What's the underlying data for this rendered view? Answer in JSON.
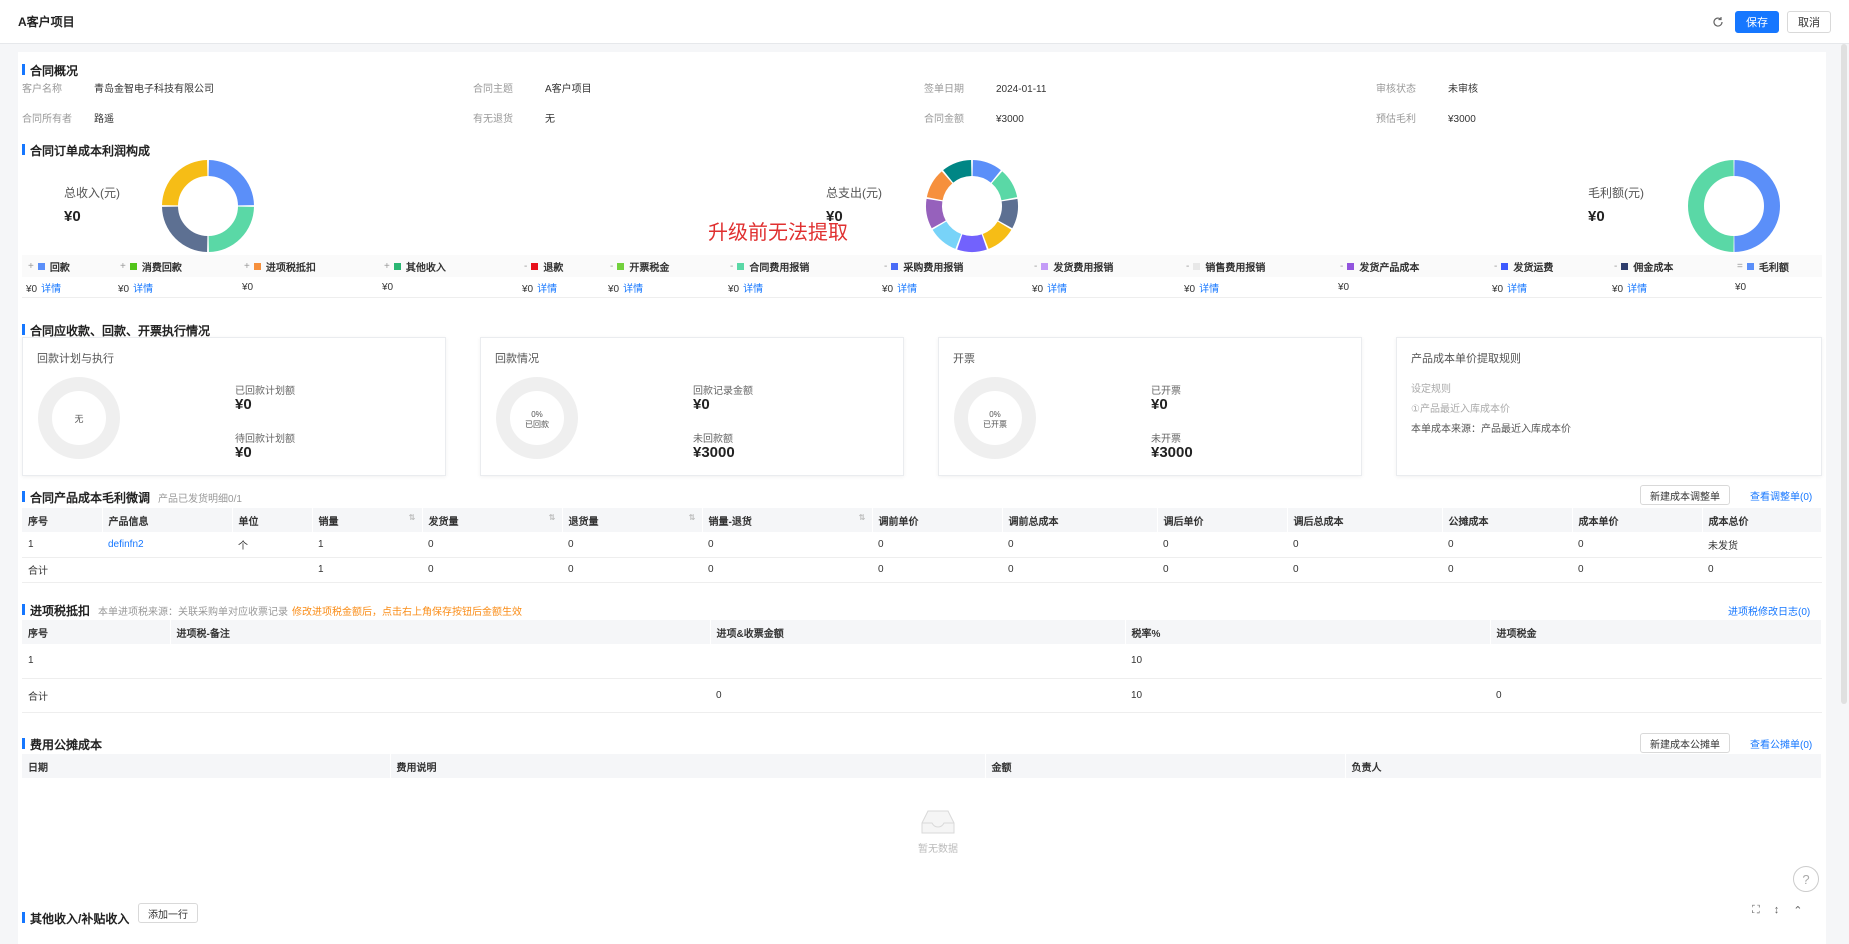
{
  "header": {
    "title": "A客户项目",
    "save_label": "保存",
    "cancel_label": "取消",
    "refresh_icon": "refresh-icon"
  },
  "overview": {
    "title": "合同概况",
    "fields": [
      {
        "label": "客户名称",
        "value": "青岛金智电子科技有限公司"
      },
      {
        "label": "合同主题",
        "value": "A客户项目"
      },
      {
        "label": "签单日期",
        "value": "2024-01-11"
      },
      {
        "label": "审核状态",
        "value": "未审核"
      },
      {
        "label": "合同所有者",
        "value": "路遥"
      },
      {
        "label": "有无退货",
        "value": "无"
      },
      {
        "label": "合同金额",
        "value": "¥3000"
      },
      {
        "label": "预估毛利",
        "value": "¥3000"
      }
    ]
  },
  "profit": {
    "title": "合同订单成本利润构成",
    "watermark": "升级前无法提取",
    "charts": [
      {
        "label": "总收入(元)",
        "value": "¥0",
        "segments": [
          {
            "color": "#5b8ff9",
            "value": 25
          },
          {
            "color": "#5ad8a6",
            "value": 25
          },
          {
            "color": "#5d7092",
            "value": 25
          },
          {
            "color": "#f6bd16",
            "value": 25
          }
        ]
      },
      {
        "label": "总支出(元)",
        "value": "¥0",
        "segments": [
          {
            "color": "#5b8ff9",
            "value": 1
          },
          {
            "color": "#5ad8a6",
            "value": 1
          },
          {
            "color": "#5d7092",
            "value": 1
          },
          {
            "color": "#f6bd16",
            "value": 1
          },
          {
            "color": "#7262fd",
            "value": 1
          },
          {
            "color": "#78d3f8",
            "value": 1
          },
          {
            "color": "#9661bc",
            "value": 1
          },
          {
            "color": "#f6903d",
            "value": 1
          },
          {
            "color": "#008685",
            "value": 1
          }
        ]
      },
      {
        "label": "毛利额(元)",
        "value": "¥0",
        "segments": [
          {
            "color": "#5b8ff9",
            "value": 50
          },
          {
            "color": "#5ad8a6",
            "value": 50
          }
        ]
      }
    ],
    "legend": [
      {
        "op": "+",
        "color": "#5b8ff9",
        "label": "回款"
      },
      {
        "op": "+",
        "color": "#52c41a",
        "label": "消费回款"
      },
      {
        "op": "+",
        "color": "#f6903d",
        "label": "进项税抵扣"
      },
      {
        "op": "+",
        "color": "#2bb673",
        "label": "其他收入"
      },
      {
        "op": "-",
        "color": "#e8101b",
        "label": "退款"
      },
      {
        "op": "-",
        "color": "#73d13d",
        "label": "开票税金"
      },
      {
        "op": "-",
        "color": "#5ad8a6",
        "label": "合同费用报销"
      },
      {
        "op": "-",
        "color": "#4a6cf7",
        "label": "采购费用报销"
      },
      {
        "op": "-",
        "color": "#c39bf7",
        "label": "发货费用报销"
      },
      {
        "op": "-",
        "color": "#e8e8e8",
        "label": "销售费用报销"
      },
      {
        "op": "-",
        "color": "#9254de",
        "label": "发货产品成本"
      },
      {
        "op": "-",
        "color": "#3d5afe",
        "label": "发货运费"
      },
      {
        "op": "-",
        "color": "#2f3e6e",
        "label": "佣金成本"
      },
      {
        "op": "=",
        "color": "#5b8ff9",
        "label": "毛利额"
      }
    ],
    "values": [
      {
        "amount": "¥0",
        "detail": "详情"
      },
      {
        "amount": "¥0",
        "detail": "详情"
      },
      {
        "amount": "¥0",
        "detail": ""
      },
      {
        "amount": "¥0",
        "detail": ""
      },
      {
        "amount": "¥0",
        "detail": "详情"
      },
      {
        "amount": "¥0",
        "detail": "详情"
      },
      {
        "amount": "¥0",
        "detail": "详情"
      },
      {
        "amount": "¥0",
        "detail": "详情"
      },
      {
        "amount": "¥0",
        "detail": "详情"
      },
      {
        "amount": "¥0",
        "detail": "详情"
      },
      {
        "amount": "¥0",
        "detail": ""
      },
      {
        "amount": "¥0",
        "detail": "详情"
      },
      {
        "amount": "¥0",
        "detail": "详情"
      },
      {
        "amount": "¥0",
        "detail": ""
      }
    ]
  },
  "execution": {
    "title": "合同应收款、回款、开票执行情况",
    "cards": [
      {
        "title": "回款计划与执行",
        "ring_text1": "无",
        "ring_text2": "",
        "l1": "已回款计划额",
        "v1": "¥0",
        "l2": "待回款计划额",
        "v2": "¥0"
      },
      {
        "title": "回款情况",
        "ring_text1": "0%",
        "ring_text2": "已回款",
        "l1": "回款记录金额",
        "v1": "¥0",
        "l2": "未回款额",
        "v2": "¥3000"
      },
      {
        "title": "开票",
        "ring_text1": "0%",
        "ring_text2": "已开票",
        "l1": "已开票",
        "v1": "¥0",
        "l2": "未开票",
        "v2": "¥3000"
      }
    ],
    "rule": {
      "title": "产品成本单价提取规则",
      "label": "设定规则",
      "item": "①产品最近入库成本价",
      "source": "本单成本来源：产品最近入库成本价"
    }
  },
  "product": {
    "title": "合同产品成本毛利微调",
    "subtitle": "产品已发货明细0/1",
    "new_btn": "新建成本调整单",
    "view_link": "查看调整单(0)",
    "columns": [
      "序号",
      "产品信息",
      "单位",
      "销量",
      "发货量",
      "退货量",
      "销量-退货",
      "调前单价",
      "调前总成本",
      "调后单价",
      "调后总成本",
      "公摊成本",
      "成本单价",
      "成本总价"
    ],
    "rows": [
      [
        "1",
        "definfn2",
        "个",
        "1",
        "0",
        "0",
        "0",
        "0",
        "0",
        "0",
        "0",
        "0",
        "0",
        "未发货"
      ],
      [
        "合计",
        "",
        "",
        "1",
        "0",
        "0",
        "0",
        "0",
        "0",
        "0",
        "0",
        "0",
        "0",
        "0"
      ]
    ]
  },
  "tax": {
    "title": "进项税抵扣",
    "subtitle": "本单进项税来源：关联采购单对应收票记录",
    "warning": "修改进项税金额后，点击右上角保存按钮后金额生效",
    "log_link": "进项税修改日志(0)",
    "columns": [
      "序号",
      "进项税-备注",
      "进项&收票金额",
      "税率%",
      "进项税金"
    ],
    "rows": [
      [
        "1",
        "",
        "",
        "10",
        ""
      ],
      [
        "合计",
        "",
        "0",
        "10",
        "0"
      ]
    ]
  },
  "fee": {
    "title": "费用公摊成本",
    "new_btn": "新建成本公摊单",
    "view_link": "查看公摊单(0)",
    "columns": [
      "日期",
      "费用说明",
      "金额",
      "负责人"
    ],
    "empty": "暂无数据"
  },
  "other": {
    "title": "其他收入/补贴收入",
    "add_btn": "添加一行"
  }
}
